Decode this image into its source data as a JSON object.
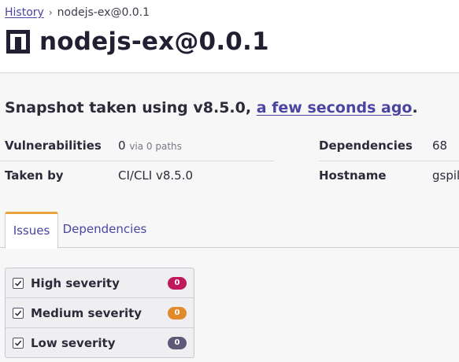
{
  "breadcrumb": {
    "history_label": "History",
    "separator": "›",
    "current": "nodejs-ex@0.0.1"
  },
  "header": {
    "title": "nodejs-ex@0.0.1",
    "icon": "project-box-icon"
  },
  "snapshot": {
    "prefix": "Snapshot taken using v8.5.0, ",
    "link": "a few seconds ago",
    "suffix": "."
  },
  "meta": {
    "vulnerabilities_label": "Vulnerabilities",
    "vulnerabilities_value": "0",
    "vulnerabilities_sub": "via 0 paths",
    "dependencies_label": "Dependencies",
    "dependencies_value": "68",
    "taken_by_label": "Taken by",
    "taken_by_value": "CI/CLI v8.5.0",
    "hostname_label": "Hostname",
    "hostname_value": "gspill"
  },
  "tabs": [
    {
      "label": "Issues",
      "active": true
    },
    {
      "label": "Dependencies",
      "active": false
    }
  ],
  "filters": [
    {
      "label": "High severity",
      "count": "0",
      "color": "#c1185b",
      "checked": true
    },
    {
      "label": "Medium severity",
      "count": "0",
      "color": "#e08a2c",
      "checked": true
    },
    {
      "label": "Low severity",
      "count": "0",
      "color": "#5d5a78",
      "checked": true
    }
  ],
  "colors": {
    "link": "#4b45a1",
    "tab_accent": "#e9a33d"
  }
}
